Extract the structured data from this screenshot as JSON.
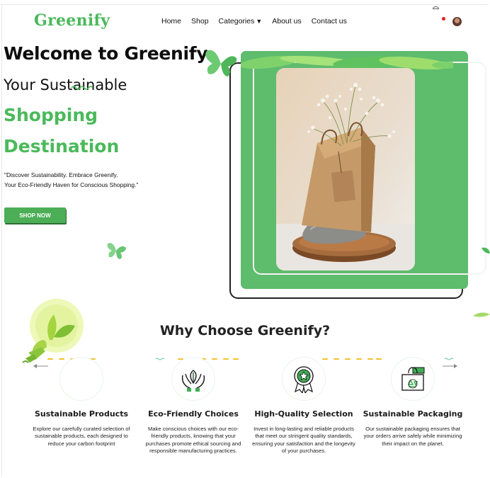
{
  "brand": {
    "logo_text": "Greenify"
  },
  "nav": {
    "items": [
      "Home",
      "Shop",
      "Categories",
      "About us",
      "Contact us"
    ]
  },
  "hero": {
    "line1": "Welcome to Greenify",
    "line2": "Your Sustainable",
    "line3": "Shopping",
    "line4": "Destination",
    "tagline_1": "\"Discover Sustainability. Embrace Greenify.",
    "tagline_2": "Your Eco-Friendly Haven for Conscious Shopping.\"",
    "cta_label": "SHOP NOW"
  },
  "why": {
    "title": "Why Choose Greenify?",
    "features": [
      {
        "title": "Sustainable Products",
        "desc": "Explore our carefully curated selection of sustainable products, each designed to reduce your carbon footprint",
        "icon": "empty-circle-icon"
      },
      {
        "title": "Eco-Friendly Choices",
        "desc": "Make conscious choices with our eco-friendly products, knowing that your purchases promote ethical sourcing and responsible manufacturing practices.",
        "icon": "hands-leaf-icon"
      },
      {
        "title": "High-Quality Selection",
        "desc": "Invest in long-lasting and reliable products that meet our stringent quality standards, ensuring your satisfaction and the longevity of your purchases.",
        "icon": "award-badge-icon"
      },
      {
        "title": "Sustainable Packaging",
        "desc": "Our sustainable packaging ensures that your orders arrive safely while minimizing their impact on the planet.",
        "icon": "recycle-bag-icon"
      }
    ]
  },
  "colors": {
    "brand_green": "#4bb95b",
    "card_green": "#5ebc6d",
    "button_green": "#4cae56",
    "dash_yellow": "#f2c230"
  }
}
